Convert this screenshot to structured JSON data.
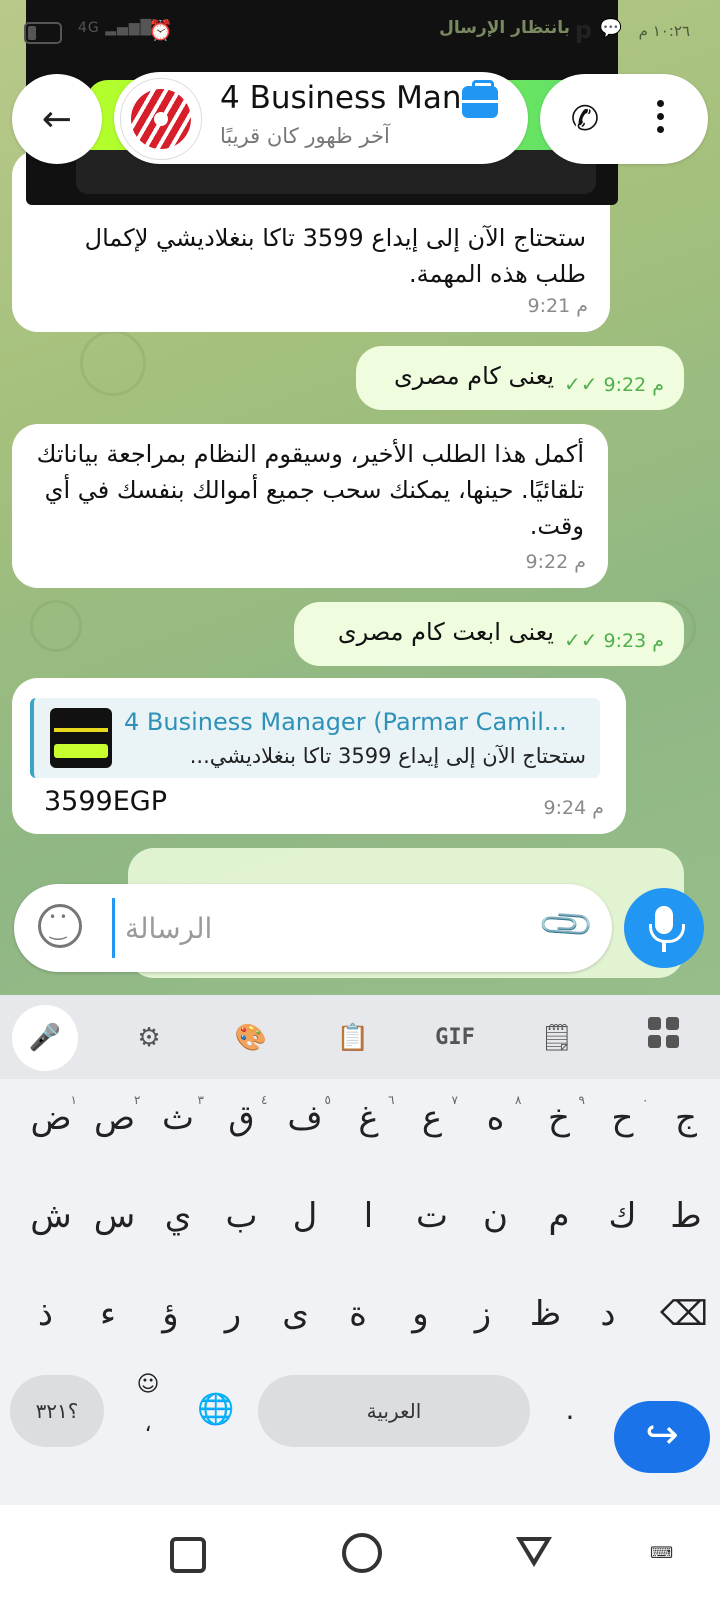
{
  "status_bar": {
    "time": "١٠:٢٦ م",
    "waiting_label": "بانتظار الإرسال",
    "network": "4G"
  },
  "header": {
    "title": "4 Business Manager",
    "subtitle": "آخر ظهور كان قريبًا"
  },
  "messages": [
    {
      "text": "ستحتاج الآن إلى إيداع 3599 تاكا بنغلاديشي لإكمال طلب هذه المهمة.",
      "time": "9:21 م"
    },
    {
      "text": "يعنى كام مصرى",
      "time": "9:22 م"
    },
    {
      "text": "أكمل هذا الطلب الأخير، وسيقوم النظام بمراجعة بياناتك تلقائيًا. حينها، يمكنك سحب جميع أموالك بنفسك في أي وقت.",
      "time": "9:22 م"
    },
    {
      "text": "يعنى ابعت كام مصرى",
      "time": "9:23 م"
    },
    {
      "reply_name": "4 Business Manager (Parmar Camil...",
      "reply_text": "ستحتاج الآن إلى إيداع 3599 تاكا بنغلاديشي...",
      "text": "3599EGP",
      "time": "9:24 م"
    }
  ],
  "composer": {
    "placeholder": "الرسالة"
  },
  "keyboard": {
    "row1": [
      {
        "char": "ج",
        "hint": ""
      },
      {
        "char": "ح",
        "hint": "٠"
      },
      {
        "char": "خ",
        "hint": "٩"
      },
      {
        "char": "ه",
        "hint": "٨"
      },
      {
        "char": "ع",
        "hint": "٧"
      },
      {
        "char": "غ",
        "hint": "٦"
      },
      {
        "char": "ف",
        "hint": "٥"
      },
      {
        "char": "ق",
        "hint": "٤"
      },
      {
        "char": "ث",
        "hint": "٣"
      },
      {
        "char": "ص",
        "hint": "٢"
      },
      {
        "char": "ض",
        "hint": "١"
      }
    ],
    "row2": [
      "ط",
      "ك",
      "م",
      "ن",
      "ت",
      "ا",
      "ل",
      "ب",
      "ي",
      "س",
      "ش"
    ],
    "row3": [
      "د",
      "ظ",
      "ز",
      "و",
      "ة",
      "ى",
      "ر",
      "ؤ",
      "ء",
      "ذ"
    ],
    "symbols_key": "؟٣٢١",
    "comma_key": "،",
    "period_key": ".",
    "space_label": "العربية",
    "gif_label": "GIF"
  },
  "icons": {
    "back": "arrow-left-icon",
    "call": "phone-icon",
    "menu": "more-vertical-icon",
    "emoji": "smiley-icon",
    "attach": "paperclip-icon",
    "mic": "microphone-icon"
  },
  "colors": {
    "accent": "#2196f3",
    "outgoing_bubble": "#effdde",
    "incoming_bubble": "#ffffff",
    "link_name": "#2e92b8",
    "tick_green": "#4fae4e"
  }
}
